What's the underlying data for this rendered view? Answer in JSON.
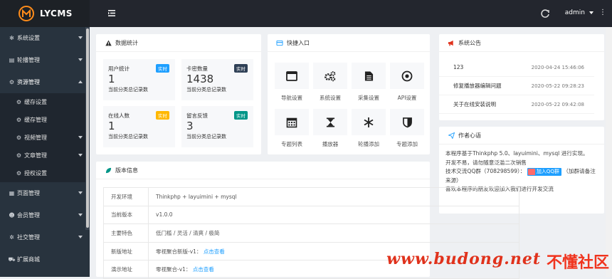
{
  "header": {
    "logo_text": "LYCMS",
    "user": "admin"
  },
  "sidebar": {
    "items": [
      {
        "label": "系统设置",
        "icon": "gear-icon"
      },
      {
        "label": "轮播管理",
        "icon": "image-icon"
      },
      {
        "label": "资源管理",
        "icon": "gears-icon",
        "expanded": true
      },
      {
        "label": "页面管理",
        "icon": "page-icon"
      },
      {
        "label": "会员管理",
        "icon": "users-icon"
      },
      {
        "label": "社交管理",
        "icon": "social-icon"
      },
      {
        "label": "扩展商城",
        "icon": "cart-icon"
      }
    ],
    "sub_items": [
      {
        "label": "缓存设置"
      },
      {
        "label": "缓存管理"
      },
      {
        "label": "视频管理"
      },
      {
        "label": "文章管理"
      },
      {
        "label": "授权设置"
      }
    ]
  },
  "stats": {
    "title": "数据统计",
    "cards": [
      {
        "title": "用户统计",
        "value": "1",
        "desc": "当前分类总记录数",
        "badge": "实时",
        "badge_color": "#1e9fff"
      },
      {
        "title": "卡密数量",
        "value": "1438",
        "desc": "当前分类总记录数",
        "badge": "实时",
        "badge_color": "#2f4056"
      },
      {
        "title": "在线人数",
        "value": "1",
        "desc": "当前分类总记录数",
        "badge": "实时",
        "badge_color": "#ffb800"
      },
      {
        "title": "留言反馈",
        "value": "3",
        "desc": "当前分类总记录数",
        "badge": "实时",
        "badge_color": "#009688"
      }
    ]
  },
  "quick": {
    "title": "快捷入口",
    "items": [
      {
        "label": "导航设置",
        "icon": "window-icon"
      },
      {
        "label": "系统设置",
        "icon": "gears-icon"
      },
      {
        "label": "采集设置",
        "icon": "file-icon"
      },
      {
        "label": "API设置",
        "icon": "dot-circle-icon"
      },
      {
        "label": "专题列表",
        "icon": "calendar-icon"
      },
      {
        "label": "播放器",
        "icon": "hourglass-icon"
      },
      {
        "label": "轮播添加",
        "icon": "snowflake-icon"
      },
      {
        "label": "专题添加",
        "icon": "shield-icon"
      }
    ]
  },
  "notice": {
    "title": "系统公告",
    "rows": [
      {
        "text": "123",
        "date": "2020-04-24 15:46:06"
      },
      {
        "text": "修复播放器编辑问题",
        "date": "2020-05-22 09:28:23"
      },
      {
        "text": "关于在线安装说明",
        "date": "2020-05-22 09:42:08"
      }
    ]
  },
  "author": {
    "title": "作者心语",
    "line1": "本程序基于Thinkphp 5.0、layuimini、mysql 进行实现。",
    "line2": "开发不易，请勿随意泛滥二次销售",
    "line3_prefix": "技术交流QQ群（708298599）：",
    "qq_button": "加入QQ群",
    "line3_suffix": "（加群请备注来源）",
    "line4": "喜欢本程序的朋友欢迎加入我们进行开发交流"
  },
  "version": {
    "title": "版本信息",
    "rows": [
      {
        "key": "开发环境",
        "value": "Thinkphp + layuimini + mysql"
      },
      {
        "key": "当前版本",
        "value": "v1.0.0"
      },
      {
        "key": "主要特色",
        "value": "低门槛 / 灵活 / 清爽 / 极简"
      },
      {
        "key": "新版地址",
        "value": "零视聚合新版-v1：",
        "link": "点击查看"
      },
      {
        "key": "演示地址",
        "value": "零视聚合-v1：",
        "link": "点击查看"
      }
    ]
  },
  "watermark": {
    "site": "www.budong.net",
    "name": "不懂社区"
  },
  "colors": {
    "sidebar_bg": "#28333e",
    "header_bg": "#23262e",
    "accent": "#1e9fff",
    "logo_orange": "#ff8c1a"
  }
}
